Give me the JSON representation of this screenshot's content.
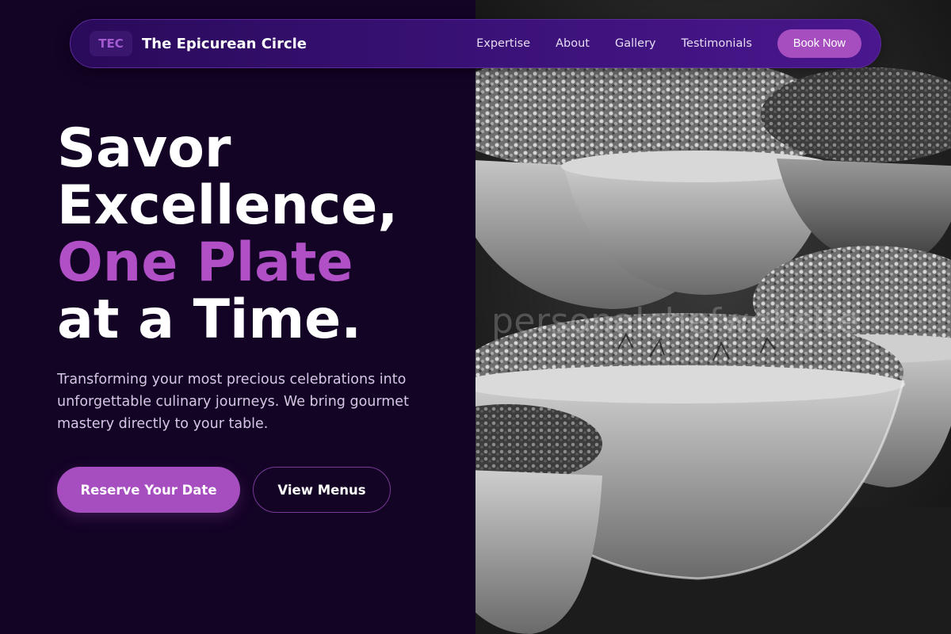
{
  "brand": {
    "logo_text": "TEC",
    "name": "The Epicurean Circle"
  },
  "nav": {
    "links": [
      "Expertise",
      "About",
      "Gallery",
      "Testimonials"
    ],
    "cta_label": "Book Now"
  },
  "hero": {
    "title_line1": "Savor",
    "title_line2": "Excellence,",
    "title_accent": "One Plate",
    "title_line4": "at a Time.",
    "description": "Transforming your most precious celebrations into unforgettable culinary journeys. We bring gourmet mastery directly to your table.",
    "primary_button": "Reserve Your Date",
    "secondary_button": "View Menus"
  },
  "image": {
    "watermark": "personalchefwebsite",
    "subject": "food-bowls-photo"
  },
  "colors": {
    "background": "#130325",
    "accent": "#b04fc6",
    "button": "#a64ec0",
    "nav_gradient_start": "#2a0a5a",
    "nav_gradient_end": "#4a178e"
  }
}
